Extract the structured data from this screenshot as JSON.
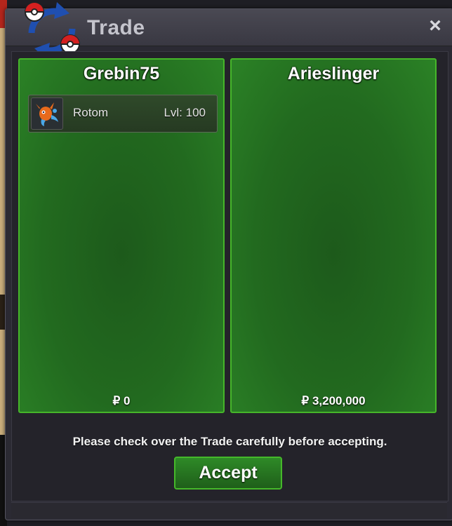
{
  "window": {
    "title": "Trade",
    "close_label": "×"
  },
  "left_player": {
    "name": "Grebin75",
    "pokemon": [
      {
        "name": "Rotom",
        "level": "Lvl: 100",
        "icon": "rotom-icon"
      }
    ],
    "money": "₽ 0"
  },
  "right_player": {
    "name": "Arieslinger",
    "money": "₽ 3,200,000"
  },
  "notice": "Please check over the Trade carefully before accepting.",
  "accept_label": "Accept",
  "colors": {
    "panel_border": "#46b62a",
    "panel_fill": "#226a1f",
    "window_bg": "#2b2a33"
  }
}
